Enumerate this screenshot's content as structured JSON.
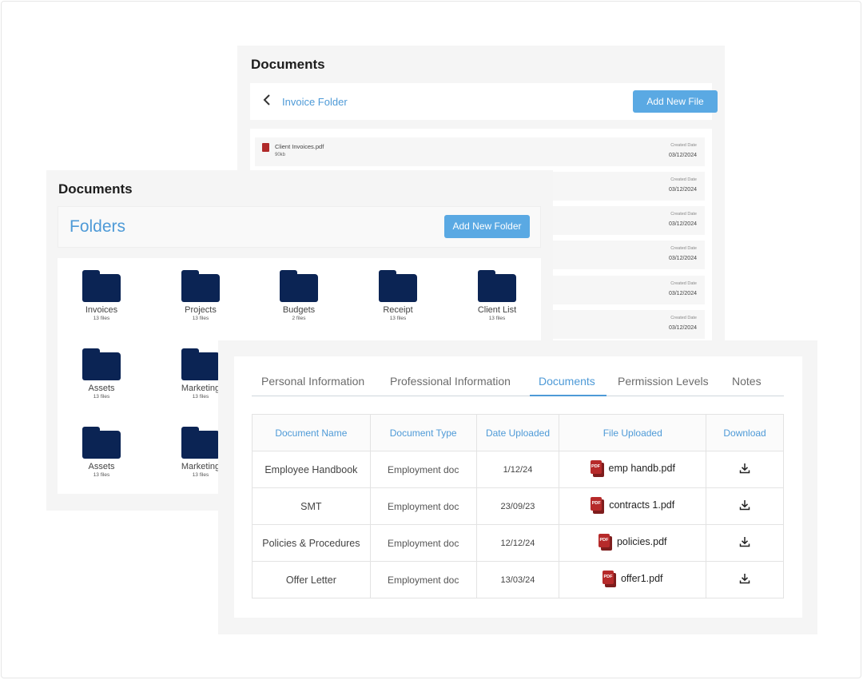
{
  "panel_invoice": {
    "title": "Documents",
    "folder_title": "Invoice Folder",
    "add_button": "Add New File",
    "files": [
      {
        "name": "Client Invoices.pdf",
        "size": "90kb",
        "created_label": "Created Date",
        "created": "03/12/2024"
      },
      {
        "name": "",
        "size": "",
        "created_label": "Created Date",
        "created": "03/12/2024"
      },
      {
        "name": "",
        "size": "",
        "created_label": "Created Date",
        "created": "03/12/2024"
      },
      {
        "name": "",
        "size": "",
        "created_label": "Created Date",
        "created": "03/12/2024"
      },
      {
        "name": "",
        "size": "",
        "created_label": "Created Date",
        "created": "03/12/2024"
      },
      {
        "name": "",
        "size": "",
        "created_label": "Created Date",
        "created": "03/12/2024"
      }
    ]
  },
  "panel_folders": {
    "title": "Documents",
    "section_title": "Folders",
    "add_button": "Add New Folder",
    "folders": [
      {
        "label": "Invoices",
        "count": "13 files"
      },
      {
        "label": "Projects",
        "count": "13 files"
      },
      {
        "label": "Budgets",
        "count": "2 files"
      },
      {
        "label": "Receipt",
        "count": "13 files"
      },
      {
        "label": "Client List",
        "count": "13 files"
      },
      {
        "label": "Assets",
        "count": "13 files"
      },
      {
        "label": "Marketing",
        "count": "13 files"
      },
      {
        "label": "Assets",
        "count": "13 files"
      },
      {
        "label": "Marketing",
        "count": "13 files"
      }
    ]
  },
  "panel_documents": {
    "tabs": [
      "Personal Information",
      "Professional Information",
      "Documents",
      "Permission Levels",
      "Notes"
    ],
    "active_tab": "Documents",
    "columns": [
      "Document Name",
      "Document Type",
      "Date Uploaded",
      "File Uploaded",
      "Download"
    ],
    "rows": [
      {
        "name": "Employee Handbook",
        "type": "Employment doc",
        "date": "1/12/24",
        "file": "emp handb.pdf"
      },
      {
        "name": "SMT",
        "type": "Employment doc",
        "date": "23/09/23",
        "file": "contracts 1.pdf"
      },
      {
        "name": "Policies & Procedures",
        "type": "Employment doc",
        "date": "12/12/24",
        "file": "policies.pdf"
      },
      {
        "name": "Offer Letter",
        "type": "Employment doc",
        "date": "13/03/24",
        "file": "offer1.pdf"
      }
    ],
    "pdf_badge": "PDF",
    "download_icon": "download-icon"
  },
  "colors": {
    "accent": "#4e9ad7",
    "button": "#5aa9e3",
    "folder": "#0b2454",
    "pdf": "#b62a2a"
  }
}
